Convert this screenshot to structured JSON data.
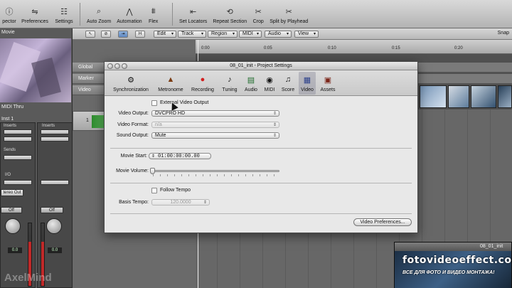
{
  "toolbar": {
    "items": [
      {
        "label": "pector",
        "icon": "info-icon"
      },
      {
        "label": "Preferences",
        "icon": "switch-icon"
      },
      {
        "label": "Settings",
        "icon": "settings-icon"
      },
      {
        "label": "Auto Zoom",
        "icon": "zoom-icon"
      },
      {
        "label": "Automation",
        "icon": "automation-icon"
      },
      {
        "label": "Flex",
        "icon": "flex-icon"
      },
      {
        "label": "Set Locators",
        "icon": "locators-icon"
      },
      {
        "label": "Repeat Section",
        "icon": "repeat-icon"
      },
      {
        "label": "Crop",
        "icon": "crop-icon"
      },
      {
        "label": "Split by Playhead",
        "icon": "split-icon"
      }
    ]
  },
  "inspector": {
    "movie_label": "Movie",
    "midi_thru": "MIDI Thru",
    "inst": "Inst 1",
    "inserts": "Inserts",
    "sends": "Sends",
    "io": "I/O",
    "stereo_out": "tereo Out",
    "off1": "Off",
    "off2": "Off",
    "val1": "0.0",
    "val2": "0.0",
    "watermark": "AxelMind"
  },
  "arrange": {
    "edit": "Edit",
    "track": "Track",
    "region": "Region",
    "midi": "MIDI",
    "audio": "Audio",
    "view": "View",
    "snap": "Snap",
    "global": "Global",
    "marker": "Marker",
    "video": "Video",
    "track_num": "1",
    "ruler": [
      "0:00",
      "0:05",
      "0:10",
      "0:15",
      "0:20"
    ]
  },
  "dialog": {
    "title": "08_01_init - Project Settings",
    "tabs": [
      {
        "label": "Synchronization",
        "icon": "sync-icon"
      },
      {
        "label": "Metronome",
        "icon": "metronome-icon"
      },
      {
        "label": "Recording",
        "icon": "record-icon"
      },
      {
        "label": "Tuning",
        "icon": "tuning-icon"
      },
      {
        "label": "Audio",
        "icon": "audio-icon"
      },
      {
        "label": "MIDI",
        "icon": "midi-icon"
      },
      {
        "label": "Score",
        "icon": "score-icon"
      },
      {
        "label": "Video",
        "icon": "video-icon"
      },
      {
        "label": "Assets",
        "icon": "assets-icon"
      }
    ],
    "selected_tab": "Video",
    "external_video_output": "External Video Output",
    "video_output_label": "Video Output:",
    "video_output_value": "DVCPRO HD",
    "video_format_label": "Video Format:",
    "video_format_value": "n/a",
    "sound_output_label": "Sound Output:",
    "sound_output_value": "Mute",
    "movie_start_label": "Movie Start:",
    "movie_start_value": "01:00:00:00.00",
    "movie_volume_label": "Movie Volume:",
    "movie_volume_level": 0,
    "follow_tempo": "Follow Tempo",
    "basis_tempo_label": "Basis Tempo:",
    "basis_tempo_value": "120.0000",
    "video_prefs_button": "Video Preferences..."
  },
  "mini_window": {
    "title": "08_01_init",
    "watermark_big": "fotovideoeffect.com",
    "watermark_small": "ВСЕ ДЛЯ ФОТО И ВИДЕО МОНТАЖА!"
  }
}
